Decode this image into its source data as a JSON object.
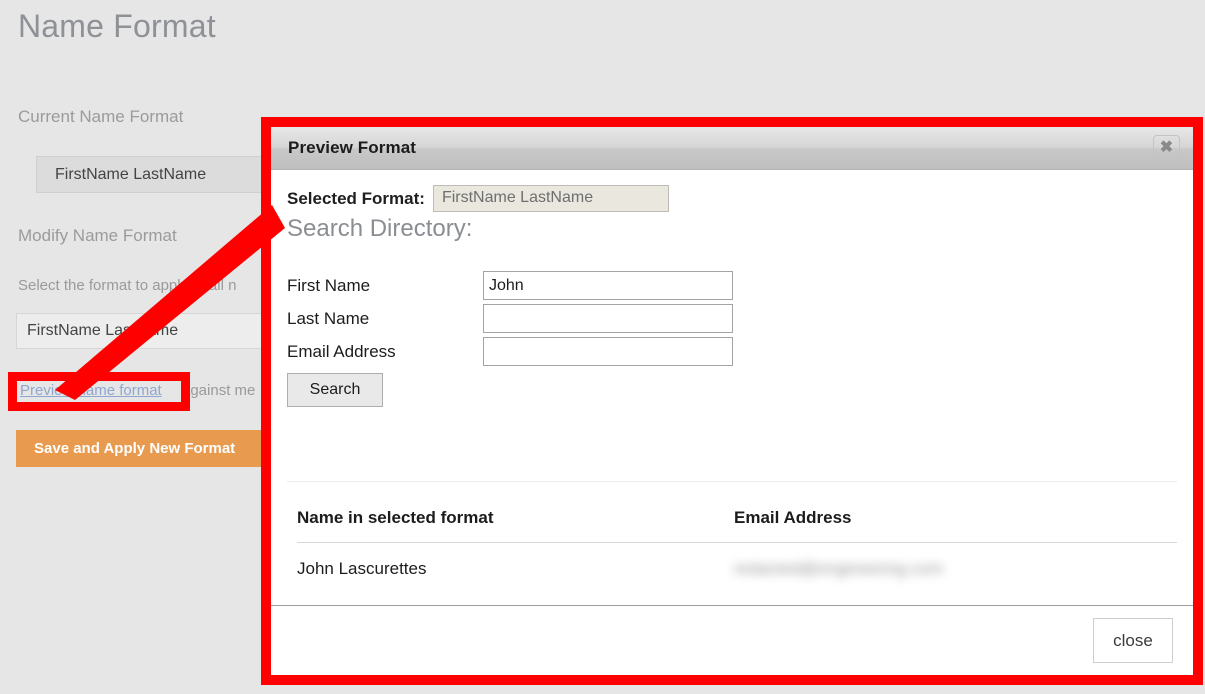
{
  "page": {
    "title": "Name Format",
    "current_format_label": "Current Name Format",
    "current_format_value": "FirstName LastName",
    "modify_format_label": "Modify Name Format",
    "helper_text": "Select the format to apply to all n",
    "modify_format_value": "FirstName LastName",
    "preview_link": "Preview name format",
    "preview_link_suffix": "against me",
    "save_button": "Save and Apply New Format",
    "accent_color": "#e89a4f",
    "background_color": "#e6e6e6",
    "link_color": "#8fa7cf"
  },
  "annotation": {
    "highlight_color": "#fe0000",
    "callout_target": "preview-name-format-link"
  },
  "modal": {
    "title": "Preview Format",
    "close_icon": "close-x-icon",
    "selected_format_label": "Selected Format:",
    "selected_format_value": "FirstName LastName",
    "search_heading": "Search Directory:",
    "fields": [
      {
        "label": "First Name",
        "value": "John",
        "placeholder": ""
      },
      {
        "label": "Last Name",
        "value": "",
        "placeholder": ""
      },
      {
        "label": "Email Address",
        "value": "",
        "placeholder": ""
      }
    ],
    "search_button": "Search",
    "results": {
      "columns": [
        "Name in selected format",
        "Email Address"
      ],
      "rows": [
        {
          "name": "John Lascurettes",
          "email": "redacted@engineering.com"
        }
      ]
    },
    "footer": {
      "close_button": "close"
    }
  }
}
